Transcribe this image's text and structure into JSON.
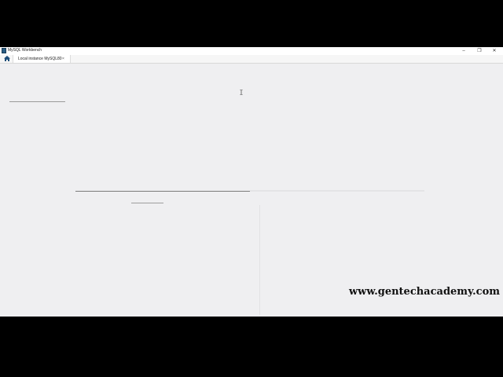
{
  "window": {
    "title": "MySQL Workbench",
    "controls": {
      "minimize": "–",
      "restore": "❐",
      "close": "✕"
    }
  },
  "tabs": {
    "home_icon": "home-icon",
    "connection_tab_label": "Local instance MySQL80",
    "connection_tab_close": "×"
  },
  "overlay": {
    "watermark": "www.gentechacademy.com"
  },
  "colors": {
    "workspace_bg": "#efeff1",
    "app_icon": "#2a5d84",
    "letterbox": "#000000"
  }
}
